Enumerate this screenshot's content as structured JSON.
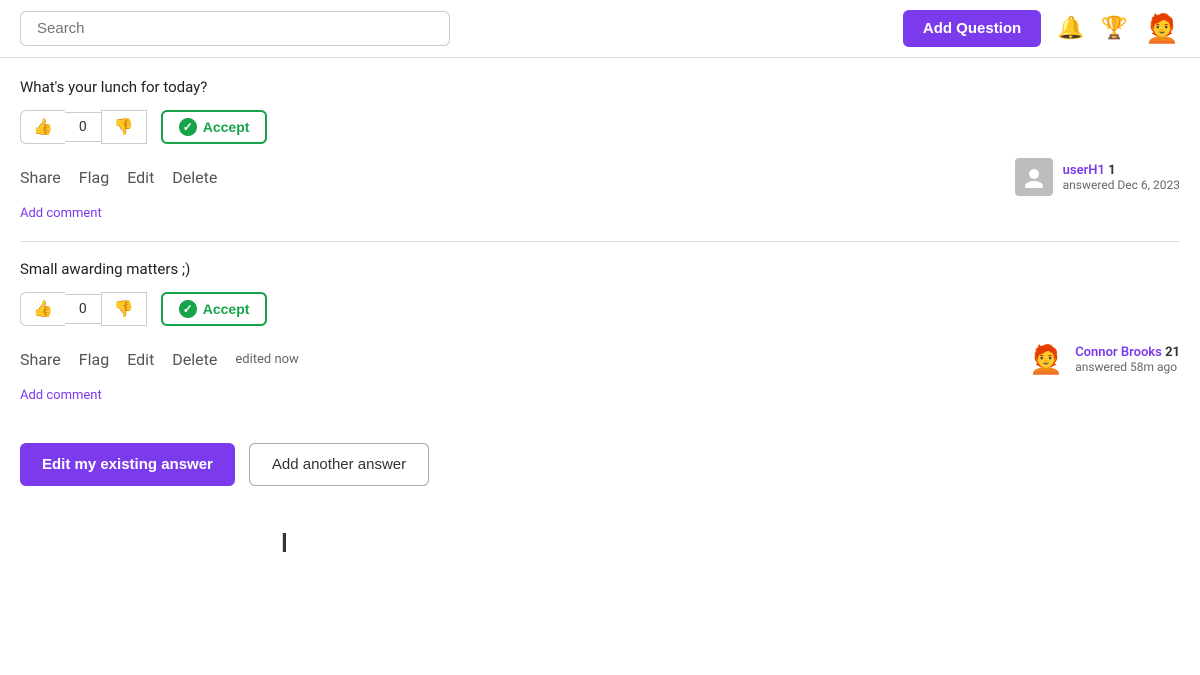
{
  "header": {
    "search_placeholder": "Search",
    "add_question_label": "Add Question",
    "notification_icon": "🔔",
    "trophy_icon": "🏆",
    "user_avatar": "🧑‍🦰"
  },
  "answers": [
    {
      "id": "answer-1",
      "text": "What's your lunch for today?",
      "vote_count": "0",
      "accept_label": "Accept",
      "actions": [
        "Share",
        "Flag",
        "Edit",
        "Delete"
      ],
      "user": {
        "avatar_type": "generic",
        "name": "userH1",
        "rep": "1",
        "answered_label": "answered Dec 6, 2023"
      },
      "add_comment_label": "Add comment"
    },
    {
      "id": "answer-2",
      "text": "Small awarding matters ;)",
      "vote_count": "0",
      "accept_label": "Accept",
      "actions": [
        "Share",
        "Flag",
        "Edit",
        "Delete"
      ],
      "edited_label": "edited now",
      "user": {
        "avatar_type": "emoji",
        "avatar": "🧑‍🦰",
        "name": "Connor Brooks",
        "rep": "21",
        "answered_label": "answered 58m ago"
      },
      "add_comment_label": "Add comment"
    }
  ],
  "bottom_buttons": {
    "edit_label": "Edit my existing answer",
    "add_label": "Add another answer"
  }
}
